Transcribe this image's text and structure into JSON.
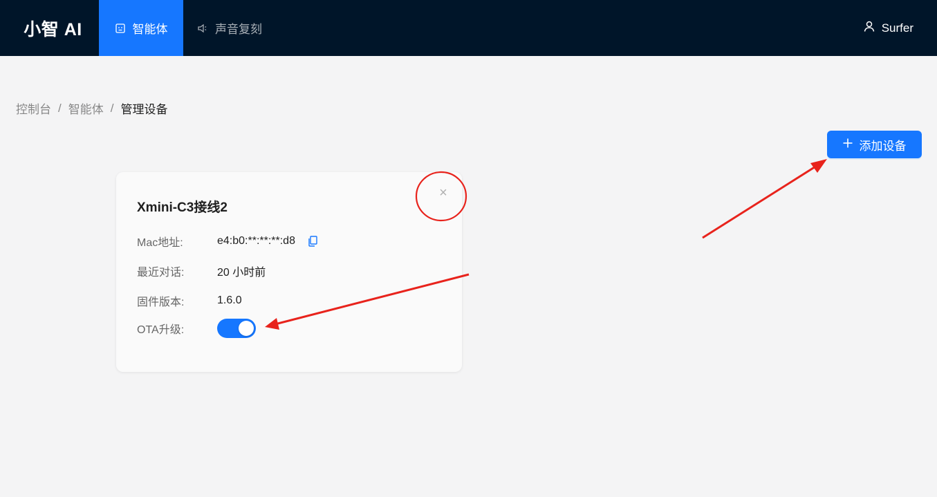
{
  "header": {
    "logo": "小智 AI",
    "nav": [
      {
        "label": "智能体",
        "icon": "robot-icon",
        "active": true
      },
      {
        "label": "声音复刻",
        "icon": "speaker-icon",
        "active": false
      }
    ],
    "user": {
      "name": "Surfer",
      "icon": "user-icon"
    }
  },
  "breadcrumb": {
    "items": [
      "控制台",
      "智能体",
      "管理设备"
    ],
    "separator": "/"
  },
  "toolbar": {
    "add_device_label": "添加设备",
    "add_icon": "plus-icon"
  },
  "device_card": {
    "title": "Xmini-C3接线2",
    "close_symbol": "×",
    "fields": {
      "mac_label": "Mac地址:",
      "mac_value": "e4:b0:**:**:**:d8",
      "last_chat_label": "最近对话:",
      "last_chat_value": "20 小时前",
      "firmware_label": "固件版本:",
      "firmware_value": "1.6.0",
      "ota_label": "OTA升级:"
    },
    "ota_enabled": true
  },
  "colors": {
    "header_bg": "#001529",
    "accent": "#1677ff",
    "annotation": "#e8231c",
    "page_bg": "#f4f4f5"
  }
}
